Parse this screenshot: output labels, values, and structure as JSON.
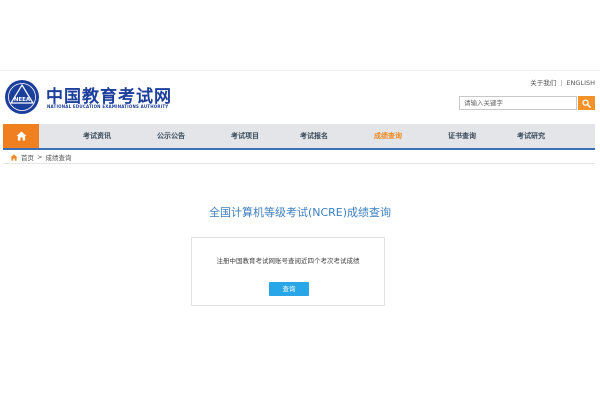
{
  "brand": {
    "title": "中国教育考试网",
    "subtitle": "NATIONAL EDUCATION EXAMINATIONS AUTHORITY",
    "logo_text": "NEEA"
  },
  "top_links": {
    "about": "关于我们",
    "separator": "|",
    "english": "ENGLISH"
  },
  "search": {
    "placeholder": "请输入关键字",
    "button_icon": "search-icon"
  },
  "nav": {
    "home_icon": "home-icon",
    "items": [
      {
        "label": "考试资讯",
        "active": false
      },
      {
        "label": "公示公告",
        "active": false
      },
      {
        "label": "考试项目",
        "active": false
      },
      {
        "label": "考试报名",
        "active": false
      },
      {
        "label": "成绩查询",
        "active": true
      },
      {
        "label": "证书查询",
        "active": false
      },
      {
        "label": "考试研究",
        "active": false
      }
    ]
  },
  "breadcrumb": {
    "home": "首页",
    "separator": ">",
    "current": "成绩查询"
  },
  "main": {
    "title": "全国计算机等级考试(NCRE)成绩查询",
    "card_text": "注册中国教育考试网账号查阅近四个考次考试成绩",
    "query_button": "查询"
  },
  "colors": {
    "brand_blue": "#1c3f9b",
    "accent_orange": "#f08a24",
    "nav_bg": "#e3e5e8",
    "nav_border": "#3b70b8",
    "title_blue": "#3d7fc1",
    "button_blue": "#29a6e8"
  }
}
